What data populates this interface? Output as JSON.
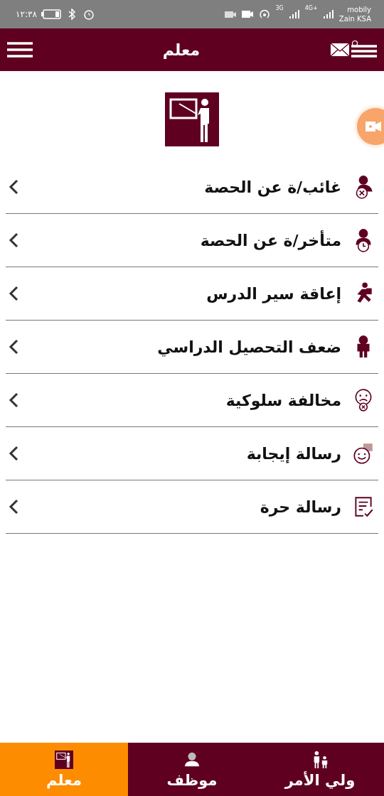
{
  "status_bar": {
    "time": "١٢:٣٨",
    "network_1": "3G",
    "network_2": "4G+",
    "carrier_1": "mobily",
    "carrier_2": "Zain KSA"
  },
  "header": {
    "title": "معلم"
  },
  "menu": [
    {
      "kind": "absent",
      "label": "غائب/ة عن الحصة"
    },
    {
      "kind": "late",
      "label": "متأخر/ة عن الحصة"
    },
    {
      "kind": "running",
      "label": "إعاقة سير الدرس"
    },
    {
      "kind": "weak",
      "label": "ضعف التحصيل الدراسي"
    },
    {
      "kind": "sad",
      "label": "مخالفة سلوكية"
    },
    {
      "kind": "happy",
      "label": "رسالة إيجابة"
    },
    {
      "kind": "note",
      "label": "رسالة حرة"
    }
  ],
  "bottom_nav": [
    {
      "kind": "parent",
      "label": "ولي الأمر",
      "selected": false
    },
    {
      "kind": "employee",
      "label": "موظف",
      "selected": false
    },
    {
      "kind": "teacher",
      "label": "معلم",
      "selected": true
    }
  ]
}
